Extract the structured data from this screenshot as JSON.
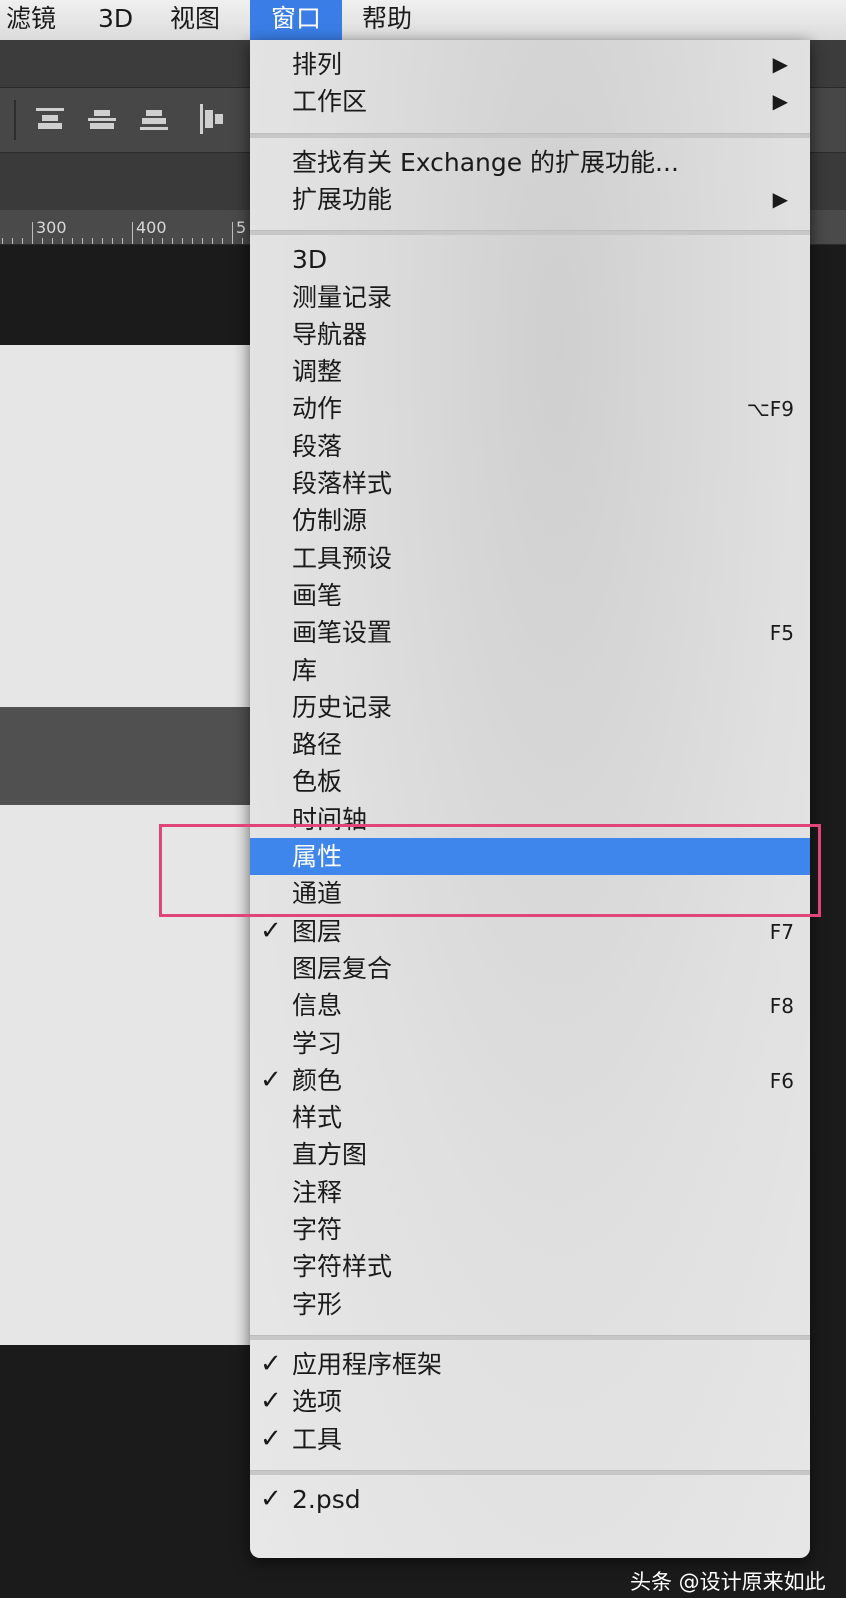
{
  "menubar": {
    "items": [
      "滤镜",
      "3D",
      "视图",
      "窗口",
      "帮助"
    ],
    "active_index": 3
  },
  "ruler": {
    "labels": [
      "300",
      "400",
      "5"
    ]
  },
  "menu": {
    "sections": [
      {
        "items": [
          {
            "label": "排列",
            "submenu": true
          },
          {
            "label": "工作区",
            "submenu": true
          }
        ]
      },
      {
        "items": [
          {
            "label": "查找有关 Exchange 的扩展功能..."
          },
          {
            "label": "扩展功能",
            "submenu": true
          }
        ]
      },
      {
        "items": [
          {
            "label": "3D"
          },
          {
            "label": "测量记录"
          },
          {
            "label": "导航器"
          },
          {
            "label": "调整"
          },
          {
            "label": "动作",
            "shortcut": "⌥F9"
          },
          {
            "label": "段落"
          },
          {
            "label": "段落样式"
          },
          {
            "label": "仿制源"
          },
          {
            "label": "工具预设"
          },
          {
            "label": "画笔"
          },
          {
            "label": "画笔设置",
            "shortcut": "F5"
          },
          {
            "label": "库"
          },
          {
            "label": "历史记录"
          },
          {
            "label": "路径"
          },
          {
            "label": "色板"
          },
          {
            "label": "时间轴"
          },
          {
            "label": "属性",
            "highlighted": true
          },
          {
            "label": "通道"
          },
          {
            "label": "图层",
            "checked": true,
            "shortcut": "F7"
          },
          {
            "label": "图层复合"
          },
          {
            "label": "信息",
            "shortcut": "F8"
          },
          {
            "label": "学习"
          },
          {
            "label": "颜色",
            "checked": true,
            "shortcut": "F6"
          },
          {
            "label": "样式"
          },
          {
            "label": "直方图"
          },
          {
            "label": "注释"
          },
          {
            "label": "字符"
          },
          {
            "label": "字符样式"
          },
          {
            "label": "字形"
          }
        ]
      },
      {
        "items": [
          {
            "label": "应用程序框架",
            "checked": true
          },
          {
            "label": "选项",
            "checked": true
          },
          {
            "label": "工具",
            "checked": true
          }
        ]
      },
      {
        "items": [
          {
            "label": "2.psd",
            "checked": true
          }
        ]
      }
    ],
    "check_glyph": "✓",
    "arrow_glyph": "▶"
  },
  "colors": {
    "accent": "#3f86ec",
    "annotation_box": "#e0457a"
  },
  "watermark": "头条 @设计原来如此"
}
